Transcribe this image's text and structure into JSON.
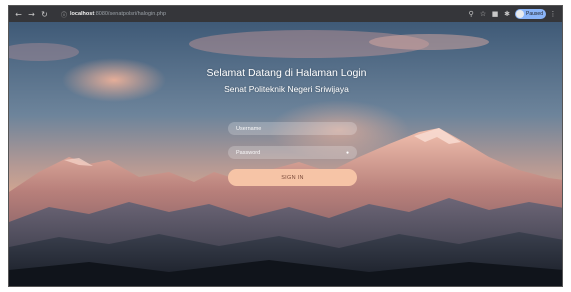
{
  "browser": {
    "url_host": "localhost",
    "url_path": ":8080/senatpolsri/halogin.php",
    "profile_label": "Paused"
  },
  "login": {
    "title": "Selamat Datang di Halaman Login",
    "subtitle": "Senat Politeknik Negeri Sriwijaya",
    "username_placeholder": "Username",
    "password_placeholder": "Password",
    "signin_label": "SIGN IN"
  },
  "colors": {
    "button_bg": "#f6c4a6",
    "chrome_bg": "#35363a"
  }
}
